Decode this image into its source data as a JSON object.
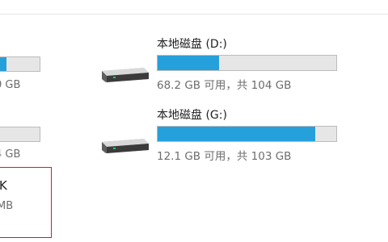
{
  "colors": {
    "bar_fill": "#26a0da",
    "bar_track": "#e6e6e6",
    "selection_border": "#e81123",
    "caption_text": "#6d6d6d"
  },
  "left_column": {
    "drive_1": {
      "used_fraction": 0.4,
      "space_text": "0 GB"
    },
    "drive_2": {
      "used_fraction": 0.0,
      "space_text": "4 GB"
    },
    "selected_item": {
      "title": "K",
      "subtitle": "MB"
    }
  },
  "drives": [
    {
      "name": "本地磁盘 (D:)",
      "space_text": "68.2 GB 可用，共 104 GB",
      "used_fraction": 0.344,
      "icon": "hard-drive-icon"
    },
    {
      "name": "本地磁盘 (G:)",
      "space_text": "12.1 GB 可用，共 103 GB",
      "used_fraction": 0.883,
      "icon": "hard-drive-icon"
    }
  ]
}
